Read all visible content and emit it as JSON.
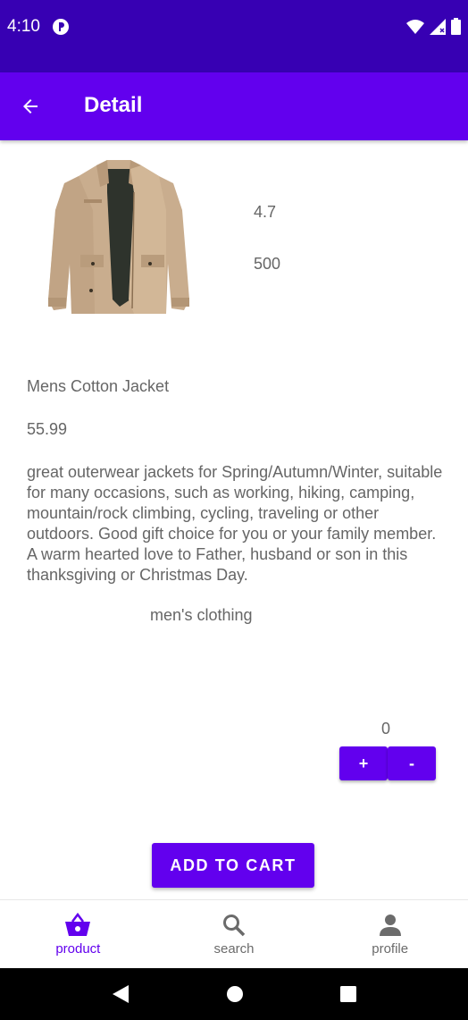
{
  "status_bar": {
    "time": "4:10",
    "icons": [
      "app-notification-icon",
      "wifi-icon",
      "signal-icon",
      "battery-icon"
    ]
  },
  "app_bar": {
    "title": "Detail",
    "back_icon": "arrow-back-icon"
  },
  "product": {
    "image_description": "jacket-image",
    "rating": "4.7",
    "count": "500",
    "title": "Mens Cotton Jacket",
    "price": "55.99",
    "description": "great outerwear jackets for Spring/Autumn/Winter, suitable for many occasions, such as working, hiking, camping, mountain/rock climbing, cycling, traveling or other outdoors. Good gift choice for you or your family member. A warm hearted love to Father, husband or son in this thanksgiving or Christmas Day.",
    "category": "men's clothing"
  },
  "quantity": {
    "value": "0",
    "plus_label": "+",
    "minus_label": "-"
  },
  "cart": {
    "add_label": "ADD TO CART"
  },
  "bottom_nav": {
    "items": [
      {
        "label": "product",
        "icon": "basket-icon",
        "active": true
      },
      {
        "label": "search",
        "icon": "search-icon",
        "active": false
      },
      {
        "label": "profile",
        "icon": "person-icon",
        "active": false
      }
    ]
  },
  "colors": {
    "status_bar": "#3700b3",
    "primary": "#6200ee",
    "text_secondary": "#666666"
  }
}
